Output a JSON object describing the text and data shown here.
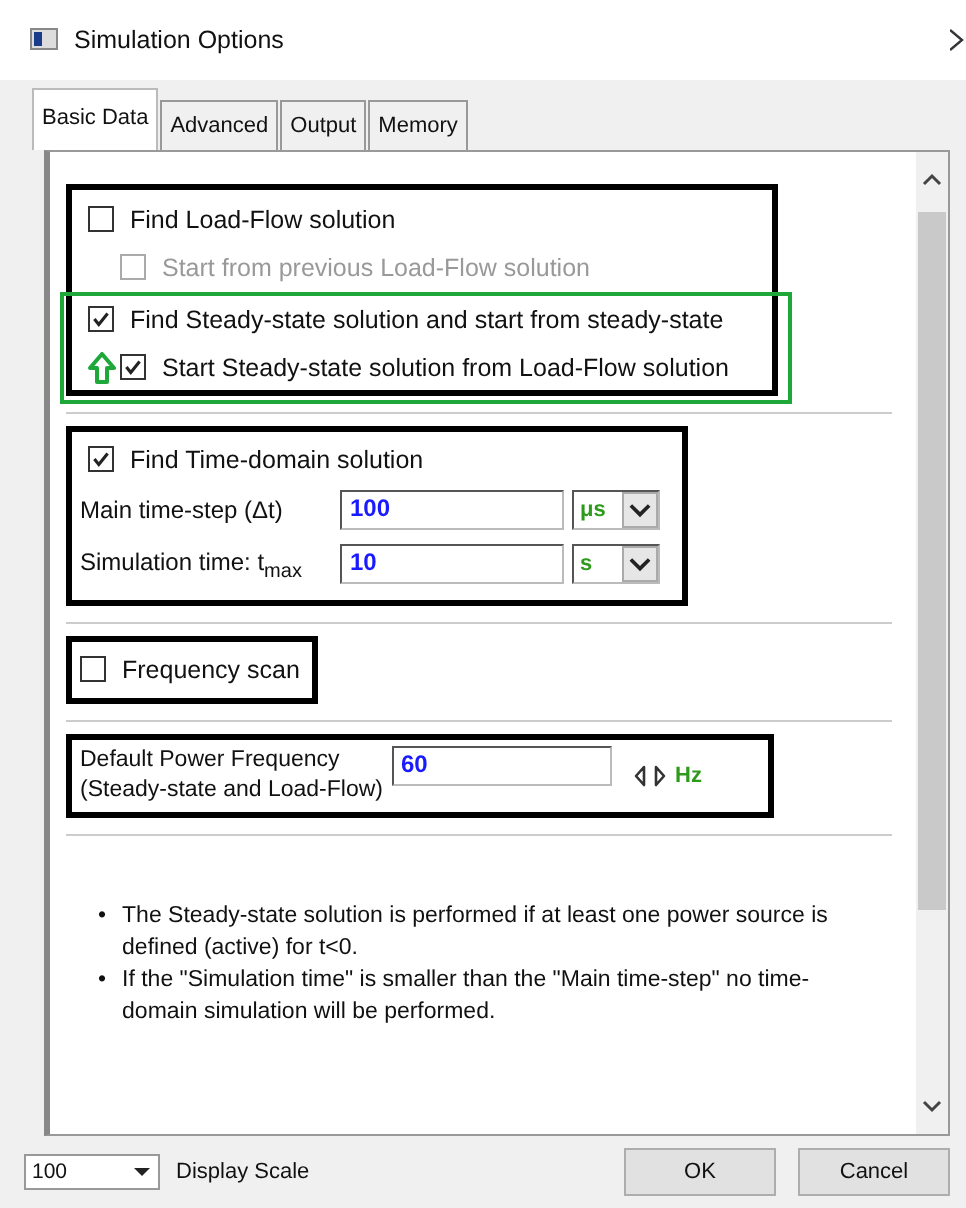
{
  "window": {
    "title": "Simulation Options"
  },
  "tabs": [
    {
      "label": "Basic Data",
      "selected": true
    },
    {
      "label": "Advanced",
      "selected": false
    },
    {
      "label": "Output",
      "selected": false
    },
    {
      "label": "Memory",
      "selected": false
    }
  ],
  "solution_options": [
    {
      "label": "Find Load-Flow solution",
      "checked": false,
      "disabled": false,
      "highlighted": false,
      "children": [
        {
          "label": "Start from previous Load-Flow solution",
          "checked": false,
          "disabled": true,
          "arrow": false
        }
      ]
    },
    {
      "label": "Find Steady-state solution and start from steady-state",
      "checked": true,
      "disabled": false,
      "highlighted": true,
      "children": [
        {
          "label": "Start Steady-state solution from Load-Flow solution",
          "checked": true,
          "disabled": false,
          "arrow": true
        }
      ]
    }
  ],
  "time_domain": {
    "label": "Find Time-domain solution",
    "checked": true,
    "fields": [
      {
        "label": "Main time-step (Δt)",
        "value": "100",
        "unit": "μs"
      },
      {
        "label": "Simulation time: t$_{max}$",
        "value": "10",
        "unit": "s"
      }
    ]
  },
  "frequency_scan": {
    "label": "Frequency scan",
    "checked": false
  },
  "power_frequency": {
    "label_lines": [
      "Default Power Frequency",
      "(Steady-state and Load-Flow)"
    ],
    "value": "60",
    "unit": "Hz"
  },
  "notes": [
    {
      "bullet": "•",
      "text": "The Steady-state solution is performed if at least one power source is defined (active) for t<0."
    },
    {
      "bullet": "•",
      "text": "If the \"Simulation time\" is smaller than the \"Main time-step\" no time-domain simulation will be performed."
    }
  ],
  "footer": {
    "scale_value": "100",
    "scale_label": "Display Scale",
    "buttons": [
      "OK",
      "Cancel"
    ]
  }
}
